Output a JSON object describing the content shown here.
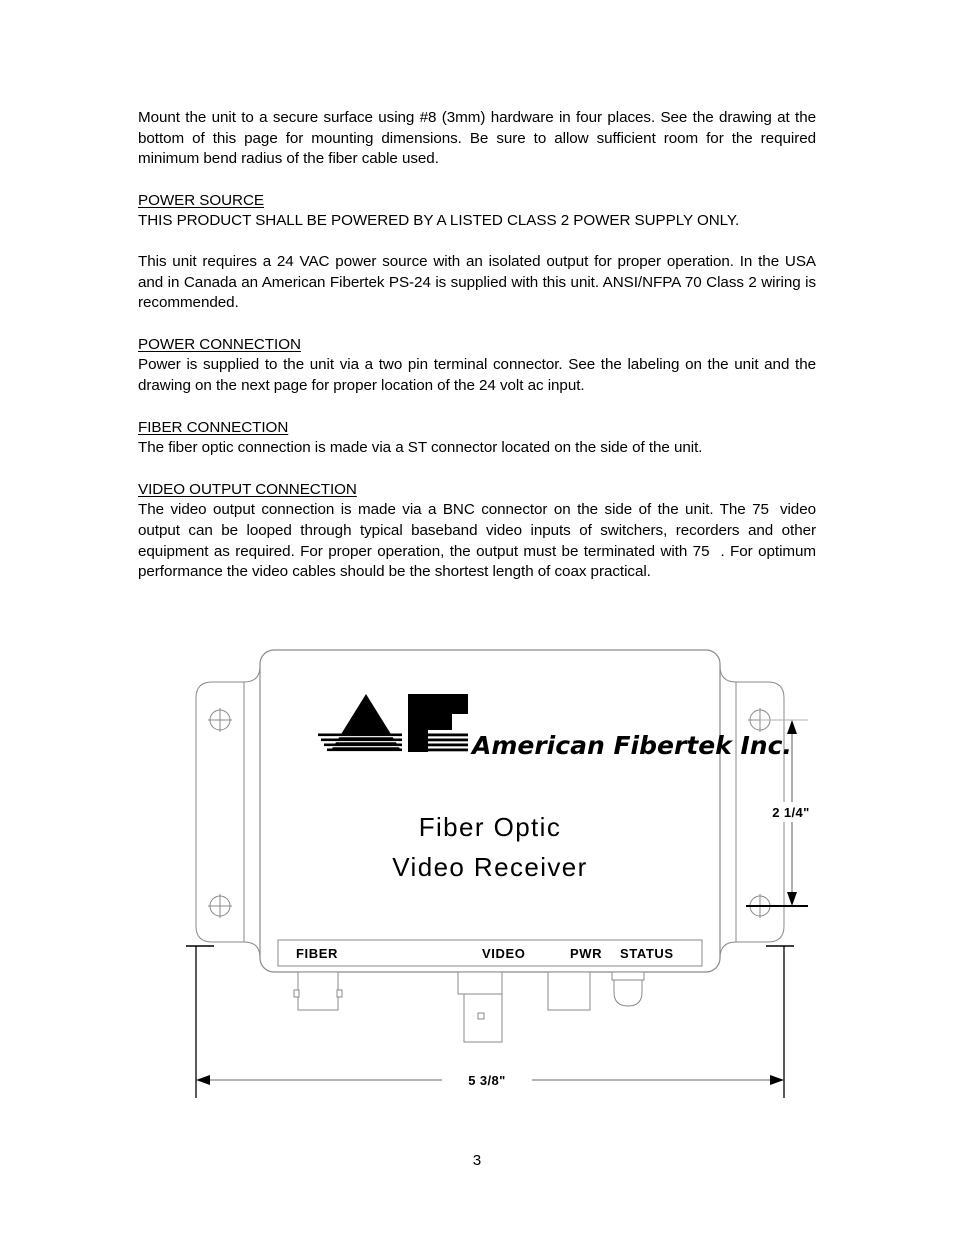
{
  "document": {
    "page_number": "3"
  },
  "body": {
    "intro_paragraph": "Mount the unit to a secure surface using #8 (3mm) hardware in four places. See the drawing at the bottom of this page for mounting dimensions. Be sure to allow sufficient room for the required minimum bend radius of the fiber cable used.",
    "sections": [
      {
        "heading": "POWER SOURCE",
        "paragraphs": [
          "THIS PRODUCT SHALL BE POWERED BY A LISTED CLASS 2 POWER SUPPLY ONLY.",
          "This unit requires a 24 VAC power source with an isolated output for proper operation. In the USA and in Canada an American Fibertek PS-24 is supplied with this unit. ANSI/NFPA 70 Class 2 wiring is recommended."
        ]
      },
      {
        "heading": "POWER CONNECTION",
        "paragraphs": [
          "Power is supplied to the unit via a two pin terminal connector. See the labeling on the unit and the drawing on the next page for proper location of the 24 volt ac input."
        ]
      },
      {
        "heading": "FIBER CONNECTION",
        "paragraphs": [
          "The fiber optic connection is made via a ST connector located on the side of the unit."
        ]
      },
      {
        "heading": "VIDEO OUTPUT CONNECTION",
        "paragraphs": [
          "The video output connection is made via a BNC connector on the side of the unit. The 75",
          "video output can be looped through typical baseband video inputs of switchers, recorders and other equipment as required. For proper operation, the output must be terminated with 75",
          ". For optimum performance the video cables should be the shortest length of coax practical."
        ]
      }
    ]
  },
  "drawing": {
    "title": "Fiber Optic Video Receiver mechanical drawing",
    "product_brand": "American Fibertek Inc.",
    "product_name_line1": "Fiber  Optic",
    "product_name_line2": "Video  Receiver",
    "panel_labels": [
      {
        "name": "fiber",
        "text": "FIBER"
      },
      {
        "name": "video",
        "text": "VIDEO"
      },
      {
        "name": "pwr",
        "text": "PWR"
      },
      {
        "name": "status",
        "text": "STATUS"
      }
    ],
    "dimensions": {
      "height_label": "2 1/4\"",
      "width_label": "5 3/8\""
    },
    "colors": {
      "outline": "#808080",
      "ink": "#000000",
      "paper": "#ffffff"
    }
  }
}
